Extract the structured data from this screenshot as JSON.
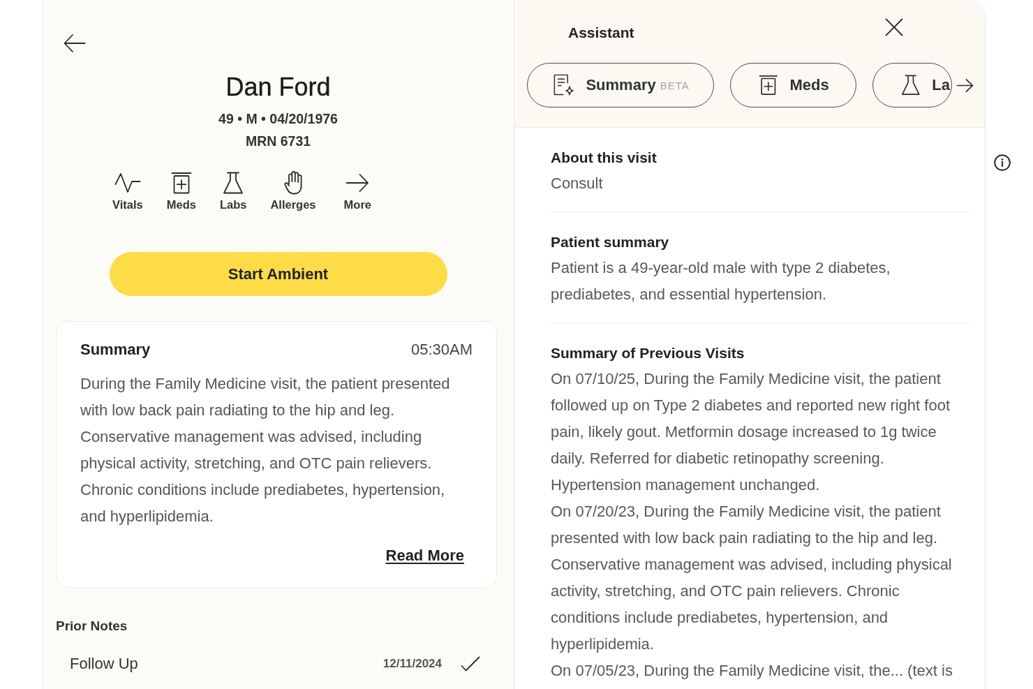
{
  "patient_panel": {
    "patient": {
      "name": "Dan Ford",
      "demographics": "49 • M • 04/20/1976",
      "mrn": "MRN 6731"
    },
    "quick_actions": [
      {
        "kind": "vitals",
        "label": "Vitals"
      },
      {
        "kind": "meds",
        "label": "Meds"
      },
      {
        "kind": "labs",
        "label": "Labs"
      },
      {
        "kind": "allergies",
        "label": "Allerges"
      },
      {
        "kind": "more",
        "label": "More"
      }
    ],
    "primary_action": {
      "label": "Start Ambient"
    },
    "summary_card": {
      "title": "Summary",
      "time": "05:30AM",
      "body": "During the Family Medicine visit, the patient presented with low back pain radiating to the hip and leg. Conservative management was advised, including physical activity, stretching, and OTC pain relievers. Chronic conditions include prediabetes, hypertension, and hyperlipidemia.",
      "link": "Read More"
    },
    "prior_notes": {
      "title": "Prior Notes",
      "notes": [
        {
          "title": "Follow Up",
          "date": "12/11/2024",
          "signed": true
        }
      ]
    }
  },
  "assistant_panel": {
    "title": "Assistant",
    "chips": [
      {
        "kind": "summary",
        "label": "Summary",
        "badge": "BETA"
      },
      {
        "kind": "meds",
        "label": "Meds"
      },
      {
        "kind": "labs",
        "label": "La"
      }
    ],
    "sections": [
      {
        "heading": "About this visit",
        "paragraphs": [
          "Consult"
        ]
      },
      {
        "heading": "Patient summary",
        "paragraphs": [
          "Patient is a 49-year-old male with type 2 diabetes, prediabetes, and essential hypertension."
        ]
      },
      {
        "heading": "Summary of Previous Visits",
        "paragraphs": [
          "On 07/10/25, During the Family Medicine visit, the patient followed up on Type 2 diabetes and reported new right foot pain, likely gout. Metformin dosage increased to 1g twice daily. Referred for diabetic retinopathy screening. Hypertension management unchanged.",
          "On 07/20/23, During the Family Medicine visit, the patient presented with low back pain radiating to the hip and leg. Conservative management was advised, including physical activity, stretching, and OTC pain relievers. Chronic conditions include prediabetes, hypertension, and hyperlipidemia.",
          "On 07/05/23, During the Family Medicine visit, the... (text is"
        ]
      }
    ]
  }
}
